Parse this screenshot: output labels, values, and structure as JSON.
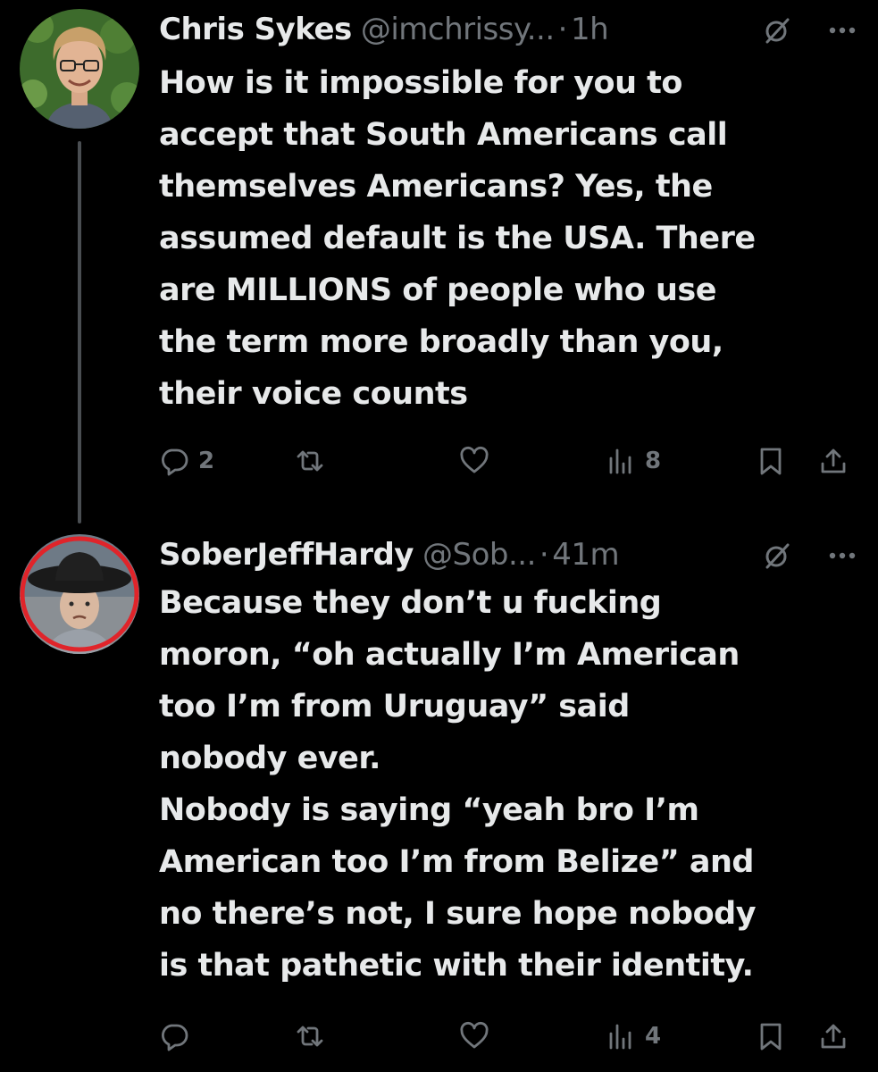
{
  "tweets": [
    {
      "display_name": "Chris Sykes",
      "handle": "@imchrissy...",
      "separator": "·",
      "time": "1h",
      "lines": [
        "How is it impossible for you to",
        "accept that South Americans call",
        "themselves Americans? Yes, the",
        "assumed default is the USA. There",
        "are MILLIONS of people who use",
        "the term more broadly than you,",
        "their voice counts"
      ],
      "reply_count": "2",
      "repost_count": "",
      "like_count": "",
      "view_count": "8"
    },
    {
      "display_name": "SoberJeffHardy",
      "handle": "@Sob...",
      "separator": "·",
      "time": "41m",
      "lines": [
        "Because they don’t u fucking",
        "moron, “oh actually I’m American",
        "too I’m from Uruguay” said",
        "nobody ever.",
        "Nobody is saying “yeah bro I’m",
        "American too I’m from Belize” and",
        "no there’s not, I sure hope nobody",
        "is that pathetic with their identity."
      ],
      "reply_count": "",
      "repost_count": "",
      "like_count": "",
      "view_count": "4"
    }
  ],
  "icons": {
    "reply": "reply-icon",
    "repost": "repost-icon",
    "like": "like-icon",
    "views": "views-icon",
    "bookmark": "bookmark-icon",
    "share": "share-icon",
    "grok": "grok-icon",
    "more": "more-icon"
  },
  "colors": {
    "background": "#000000",
    "text": "#e7e9ea",
    "secondary": "#71767b",
    "thread_line": "#4a4e52"
  }
}
